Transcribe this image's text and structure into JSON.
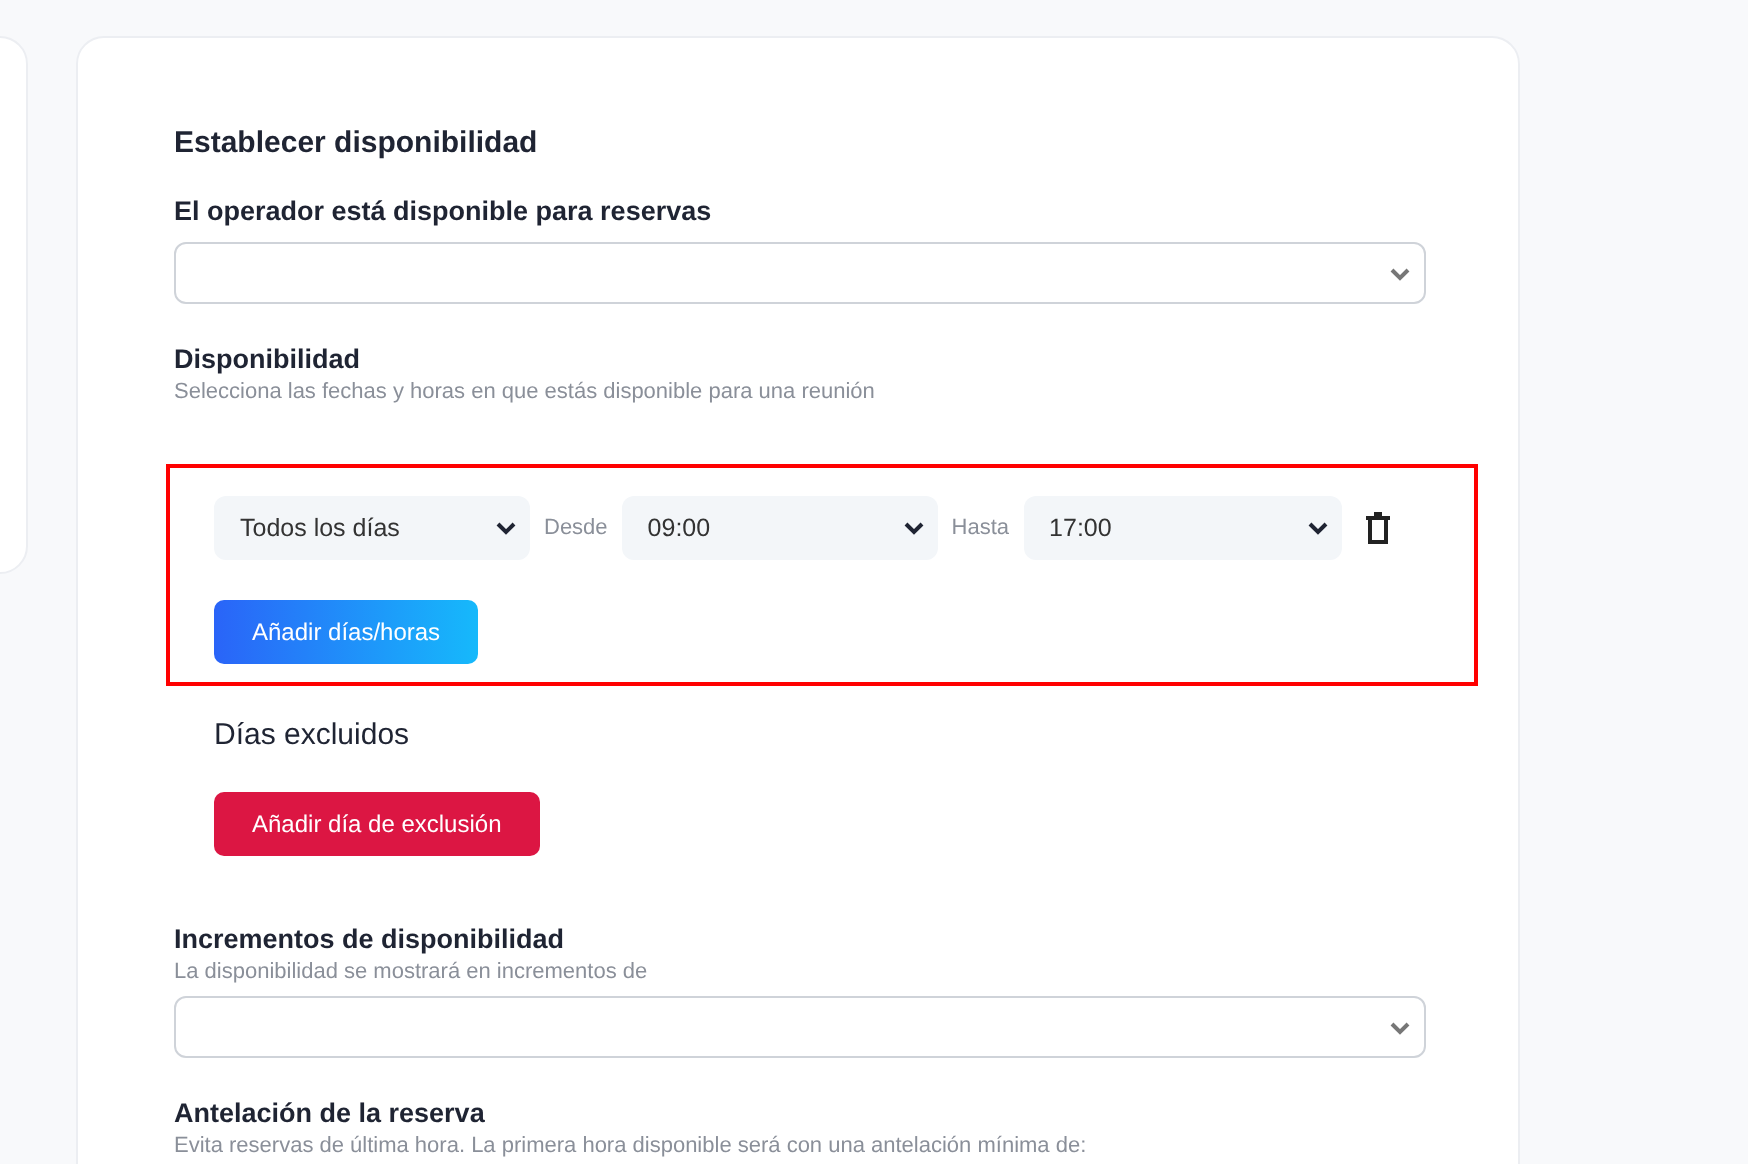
{
  "title": "Establecer disponibilidad",
  "operator_field": {
    "label": "El operador está disponible para reservas"
  },
  "availability": {
    "label": "Disponibilidad",
    "hint": "Selecciona las fechas y horas en que estás disponible para una reunión",
    "highlighted": true,
    "rows": [
      {
        "day": "Todos los días",
        "from_label": "Desde",
        "from": "09:00",
        "to_label": "Hasta",
        "to": "17:00"
      }
    ],
    "add_button": "Añadir días/horas"
  },
  "excluded": {
    "label": "Días excluidos",
    "add_button": "Añadir día de exclusión"
  },
  "increments_field": {
    "label": "Incrementos de disponibilidad",
    "hint": "La disponibilidad se mostrará en incrementos de"
  },
  "notice_field": {
    "label": "Antelación de la reserva",
    "hint": "Evita reservas de última hora. La primera hora disponible será con una antelación mínima de:"
  }
}
